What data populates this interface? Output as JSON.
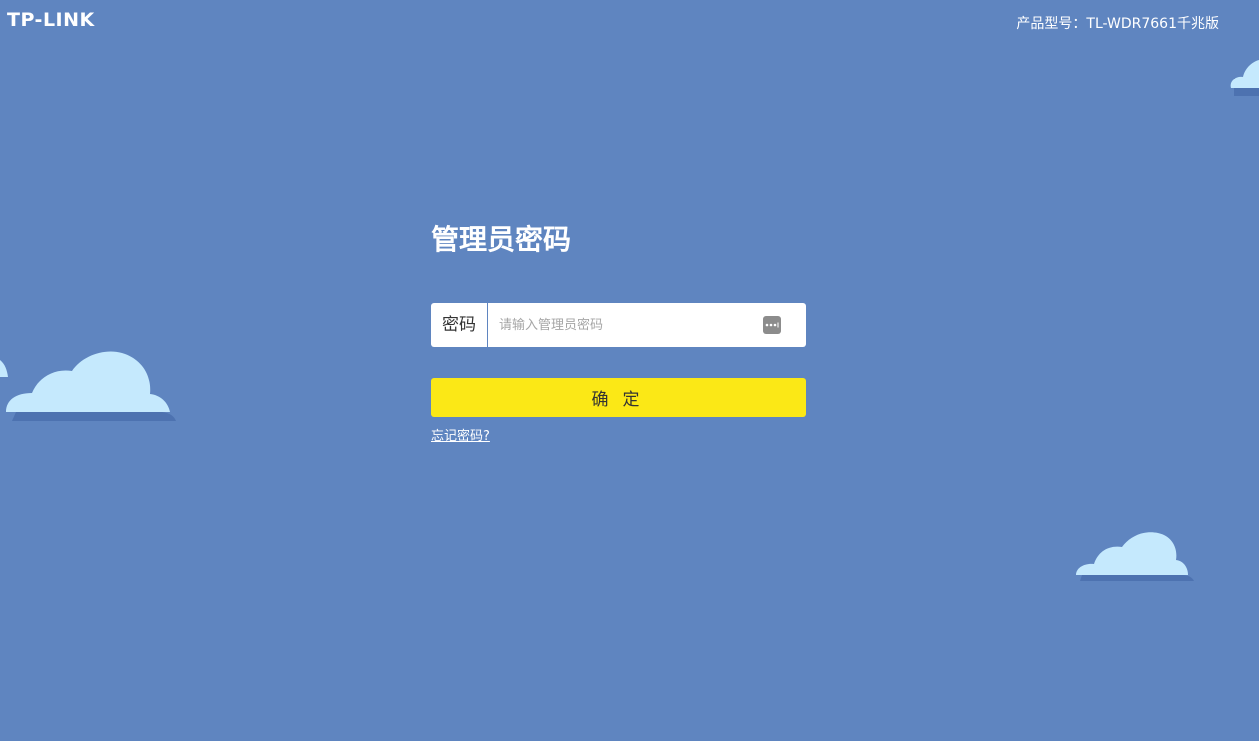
{
  "header": {
    "logo_text": "TP-LINK",
    "model_label": "产品型号：TL-WDR7661千兆版"
  },
  "login": {
    "title": "管理员密码",
    "password_label": "密码",
    "password_placeholder": "请输入管理员密码",
    "password_value": "",
    "confirm_label": "确定",
    "forgot_label": "忘记密码?"
  },
  "icons": {
    "visibility_toggle": "password-visibility-icon",
    "clouds": "cloud-icon"
  },
  "colors": {
    "background": "#5f85c0",
    "cloud": "#c5e9fd",
    "cloud_shadow": "#4d72b0",
    "confirm_button": "#fbe816",
    "text_white": "#ffffff",
    "text_dark": "#333333"
  }
}
